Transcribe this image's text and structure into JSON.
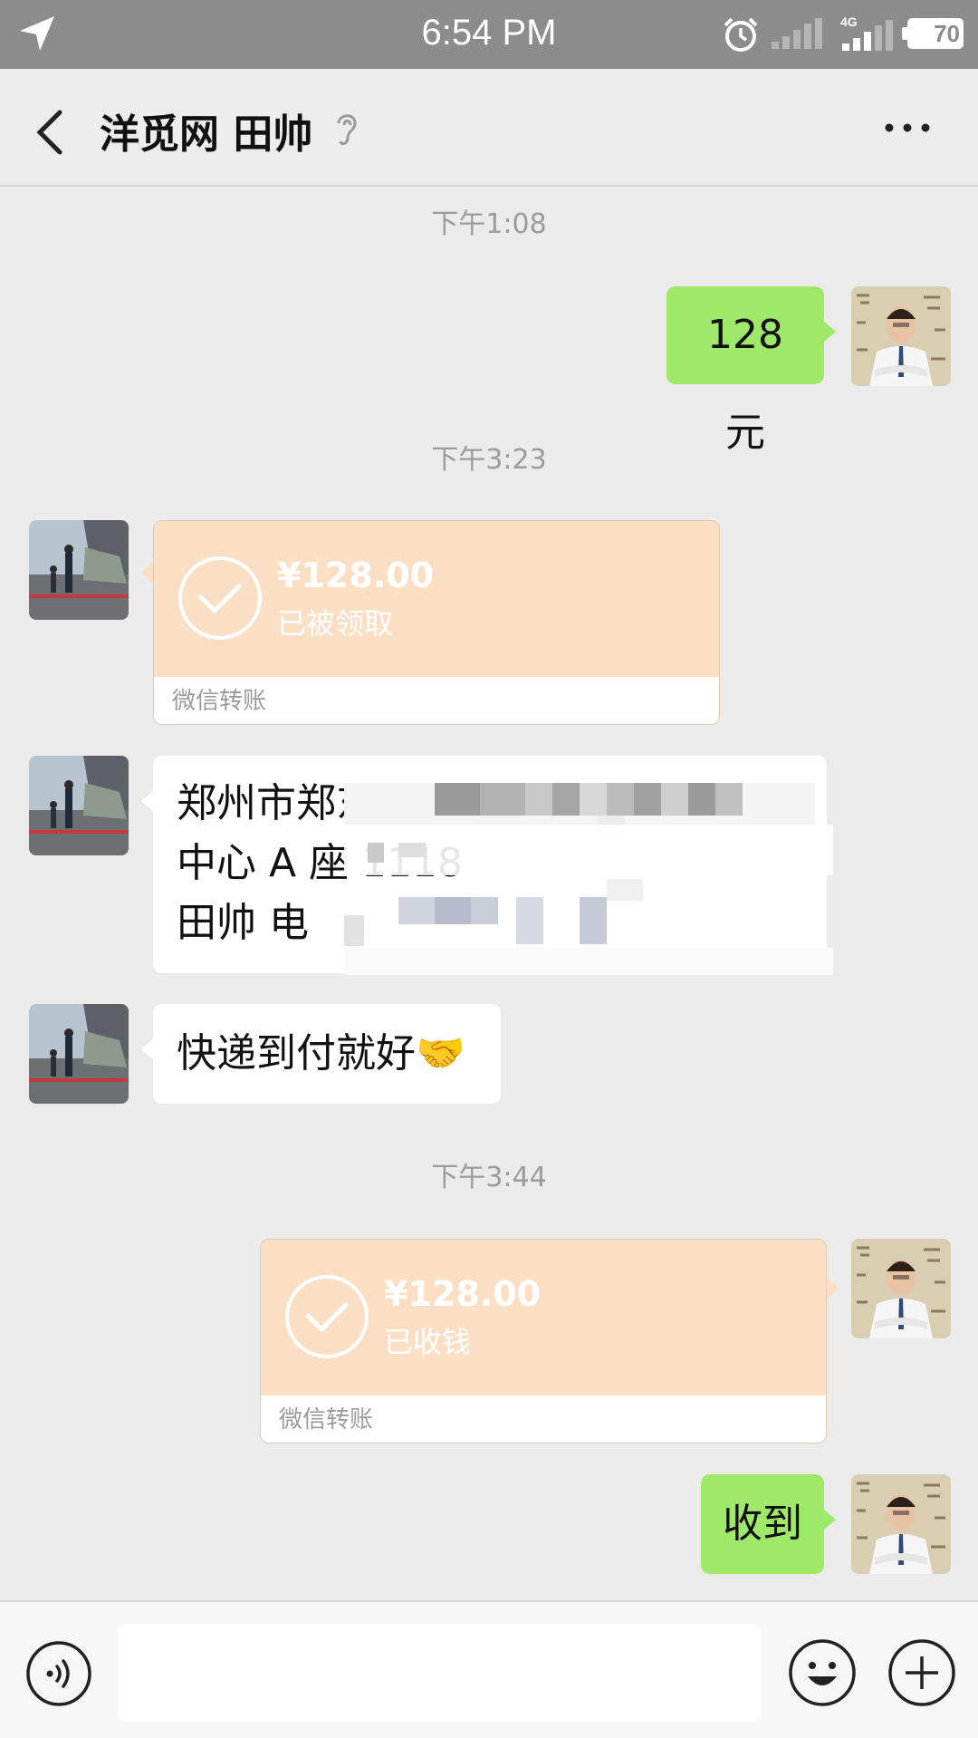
{
  "status_bar": {
    "time": "6:54 PM",
    "network": "4G",
    "battery": "70"
  },
  "header": {
    "title": "洋觅网 田帅"
  },
  "messages": {
    "ts1": "下午1:08",
    "m1_text": "128 元",
    "ts2": "下午3:23",
    "transfer1": {
      "amount": "¥128.00",
      "status": "已被领取",
      "footer": "微信转账"
    },
    "address_lines": [
      "郑州市郑东",
      "国际",
      "中心 A 座 1118",
      "田帅 电"
    ],
    "m4_text": "快递到付就好🤝",
    "ts3": "下午3:44",
    "transfer2": {
      "amount": "¥128.00",
      "status": "已收钱",
      "footer": "微信转账"
    },
    "m6_text": "收到"
  },
  "input": {
    "placeholder": ""
  },
  "colors": {
    "status_bar_bg": "#8c8c8c",
    "chat_bg": "#ebebeb",
    "sent_bubble": "#9ee86a",
    "transfer_bg": "#fbdfc4"
  }
}
